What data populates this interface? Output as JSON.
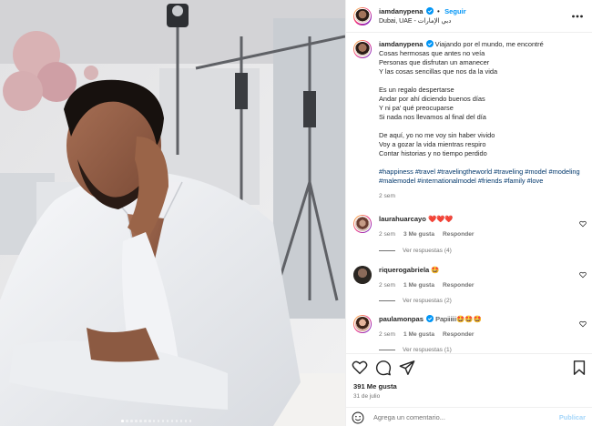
{
  "post": {
    "username": "iamdanypena",
    "follow_label": "Seguir",
    "separator": "•",
    "location": "Dubai, UAE - دبي الإمارات",
    "caption_lines": [
      "Viajando por el mundo, me encontré",
      "Cosas hermosas que antes no veía",
      "Personas que disfrutan un amanecer",
      "Y las cosas sencillas que nos da la vida",
      "",
      "Es un regalo despertarse",
      "Andar por ahí diciendo buenos días",
      "Y ni pa' qué preocuparse",
      "Si nada nos llevamos al final del día",
      "",
      "De aquí, yo no me voy sin haber vivido",
      "Voy a gozar la vida mientras respiro",
      "Contar historias y no tiempo perdido"
    ],
    "hashtags": "#happiness #travel #travelingtheworld #traveling #model #modeling #malemodel #internationalmodel #friends #family #love",
    "caption_time": "2 sem",
    "likes": "391 Me gusta",
    "date": "31 de julio"
  },
  "comments": [
    {
      "username": "laurahuarcayo",
      "verified": false,
      "text": "❤️❤️❤️",
      "time": "2 sem",
      "likes": "3 Me gusta",
      "reply_label": "Responder",
      "view_replies": "Ver respuestas (4)"
    },
    {
      "username": "riquerogabriela",
      "verified": false,
      "text": "🤩",
      "time": "2 sem",
      "likes": "1 Me gusta",
      "reply_label": "Responder",
      "view_replies": "Ver respuestas (2)"
    },
    {
      "username": "paulamonpas",
      "verified": true,
      "text": "Papiiiiii🤩🤩🤩",
      "time": "2 sem",
      "likes": "1 Me gusta",
      "reply_label": "Responder",
      "view_replies": "Ver respuestas (1)"
    }
  ],
  "composer": {
    "placeholder": "Agrega un comentario...",
    "publish_label": "Publicar"
  },
  "icons": {
    "more": "more-options-icon",
    "verified": "verified-badge-icon",
    "like": "heart-icon",
    "comment": "comment-bubble-icon",
    "share": "paper-plane-icon",
    "save": "bookmark-icon",
    "emoji": "emoji-icon"
  },
  "colors": {
    "link_blue": "#0095f6",
    "hashtag_blue": "#00376b",
    "muted": "#737373",
    "heart_red": "#ed4956",
    "publish_disabled": "#a5d6fa"
  },
  "carousel": {
    "count": 16,
    "active_index": 0
  }
}
